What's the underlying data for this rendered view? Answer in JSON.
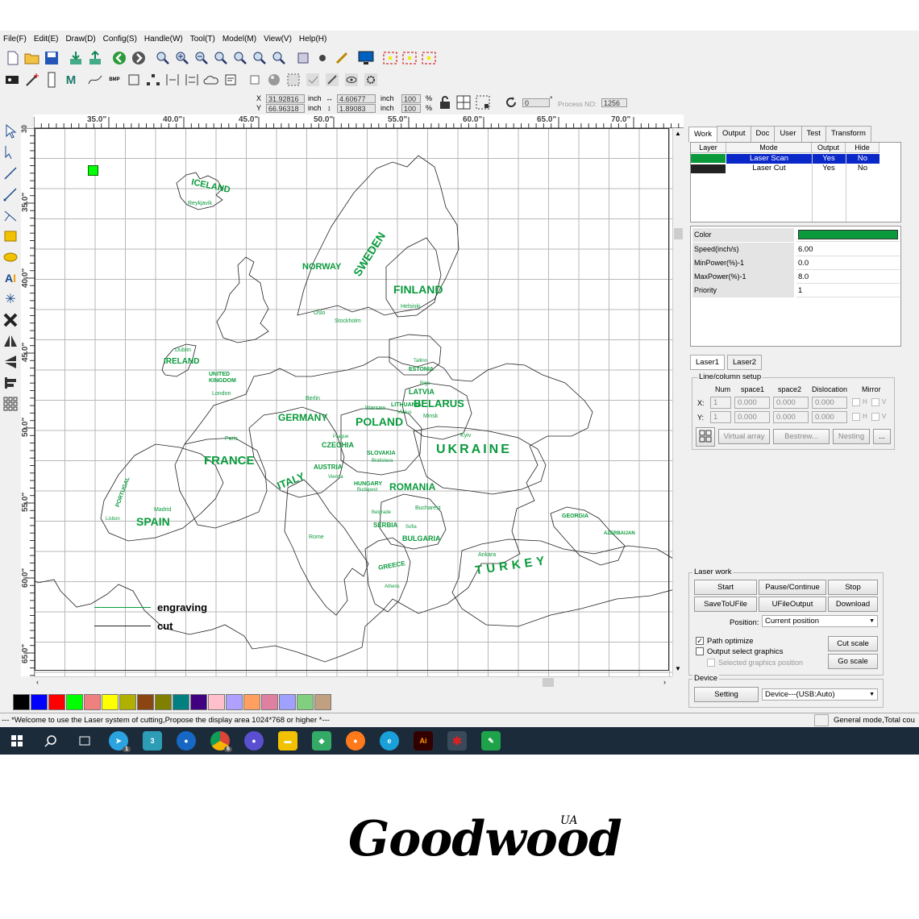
{
  "menu": [
    "File(F)",
    "Edit(E)",
    "Draw(D)",
    "Config(S)",
    "Handle(W)",
    "Tool(T)",
    "Model(M)",
    "View(V)",
    "Help(H)"
  ],
  "coords": {
    "x_label": "X",
    "y_label": "Y",
    "x_value": "31.92816",
    "y_value": "66.96318",
    "unit": "inch",
    "w_value": "4.60677",
    "h_value": "1.89083",
    "w_pct": "100",
    "h_pct": "100",
    "pct_sign": "%",
    "rotate": "0",
    "degree": "°",
    "process_label": "Process NO:",
    "process_no": "1256"
  },
  "ruler": {
    "h_labels": [
      "35.0\"",
      "40.0\"",
      "45.0\"",
      "50.0\"",
      "55.0\"",
      "60.0\"",
      "65.0\"",
      "70.0\""
    ],
    "v_labels": [
      "30",
      "35.0\"",
      "40.0\"",
      "45.0\"",
      "50.0\"",
      "55.0\"",
      "60.0\"",
      "65.0\""
    ]
  },
  "map": {
    "countries": [
      "ICELAND",
      "NORWAY",
      "SWEDEN",
      "FINLAND",
      "IRELAND",
      "UNITED KINGDOM",
      "GERMANY",
      "POLAND",
      "BELARUS",
      "UKRAINE",
      "FRANCE",
      "SPAIN",
      "ITALY",
      "ROMANIA",
      "TURKEY",
      "ESTONIA",
      "LATVIA",
      "LITHUANIA",
      "CZECHIA",
      "AUSTRIA",
      "HUNGARY",
      "SLOVAKIA",
      "SERBIA",
      "BULGARIA",
      "GREECE",
      "PORTUGAL",
      "GEORGIA",
      "AZERBAIJAN"
    ],
    "cities": [
      "Reykjavik",
      "Oslo",
      "Stockholm",
      "Helsinki",
      "Tallinn",
      "Riga",
      "Vilnius",
      "Minsk",
      "Dublin",
      "London",
      "Berlin",
      "Warsaw",
      "Kyiv",
      "Paris",
      "Prague",
      "Vienna",
      "Budapest",
      "Bratislava",
      "Bucharest",
      "Madrid",
      "Lisbon",
      "Rome",
      "Athens",
      "Sofia",
      "Belgrade",
      "Ankara"
    ],
    "legend_engraving": "engraving",
    "legend_cut": "cut"
  },
  "panel": {
    "tabs": [
      "Work",
      "Output",
      "Doc",
      "User",
      "Test",
      "Transform"
    ],
    "layer_headers": [
      "Layer",
      "Mode",
      "Output",
      "Hide"
    ],
    "layers": [
      {
        "color": "#0a9a3c",
        "mode": "Laser Scan",
        "output": "Yes",
        "hide": "No"
      },
      {
        "color": "#222222",
        "mode": "Laser Cut",
        "output": "Yes",
        "hide": "No"
      }
    ],
    "props": [
      {
        "k": "Color",
        "v": ""
      },
      {
        "k": "Speed(inch/s)",
        "v": "6.00"
      },
      {
        "k": "MinPower(%)-1",
        "v": "0.0"
      },
      {
        "k": "MaxPower(%)-1",
        "v": "8.0"
      },
      {
        "k": "Priority",
        "v": "1"
      }
    ],
    "laser_tabs": [
      "Laser1",
      "Laser2"
    ],
    "linecol_title": "Line/column setup",
    "linecol_headers": [
      "Num",
      "space1",
      "space2",
      "Dislocation",
      "Mirror"
    ],
    "row_x": {
      "label": "X:",
      "num": "1",
      "s1": "0.000",
      "s2": "0.000",
      "dis": "0.000"
    },
    "row_y": {
      "label": "Y:",
      "num": "1",
      "s1": "0.000",
      "s2": "0.000",
      "dis": "0.000"
    },
    "mirror_h": "H",
    "mirror_v": "V",
    "virtual_array": "Virtual array",
    "bestrew": "Bestrew...",
    "nesting": "Nesting",
    "more": "...",
    "laserwork_title": "Laser work",
    "btn_start": "Start",
    "btn_pause": "Pause/Continue",
    "btn_stop": "Stop",
    "btn_saveu": "SaveToUFile",
    "btn_ufile": "UFileOutput",
    "btn_download": "Download",
    "position_label": "Position:",
    "position_value": "Current position",
    "path_opt": "Path optimize",
    "output_sel": "Output select graphics",
    "sel_pos": "Selected graphics position",
    "cut_scale": "Cut scale",
    "go_scale": "Go scale",
    "device_title": "Device",
    "setting": "Setting",
    "device_value": "Device---(USB:Auto)"
  },
  "palette": [
    "#000000",
    "#0000ff",
    "#ff0000",
    "#00ff00",
    "#f08080",
    "#ffff00",
    "#b0b000",
    "#8b4513",
    "#808000",
    "#008080",
    "#400080",
    "#ffc0cb",
    "#b0a0ff",
    "#ffa060",
    "#e080a0",
    "#a0a0ff",
    "#80d080",
    "#c0a080"
  ],
  "status": {
    "message": "--- *Welcome to use the Laser system of cutting,Propose the display area 1024*768 or higher *---",
    "mode": "General mode,Total cou"
  },
  "taskbar_badges": {
    "telegram": "1",
    "chrome": "6"
  },
  "brand": {
    "name": "Goodwood",
    "suffix": "UA"
  }
}
